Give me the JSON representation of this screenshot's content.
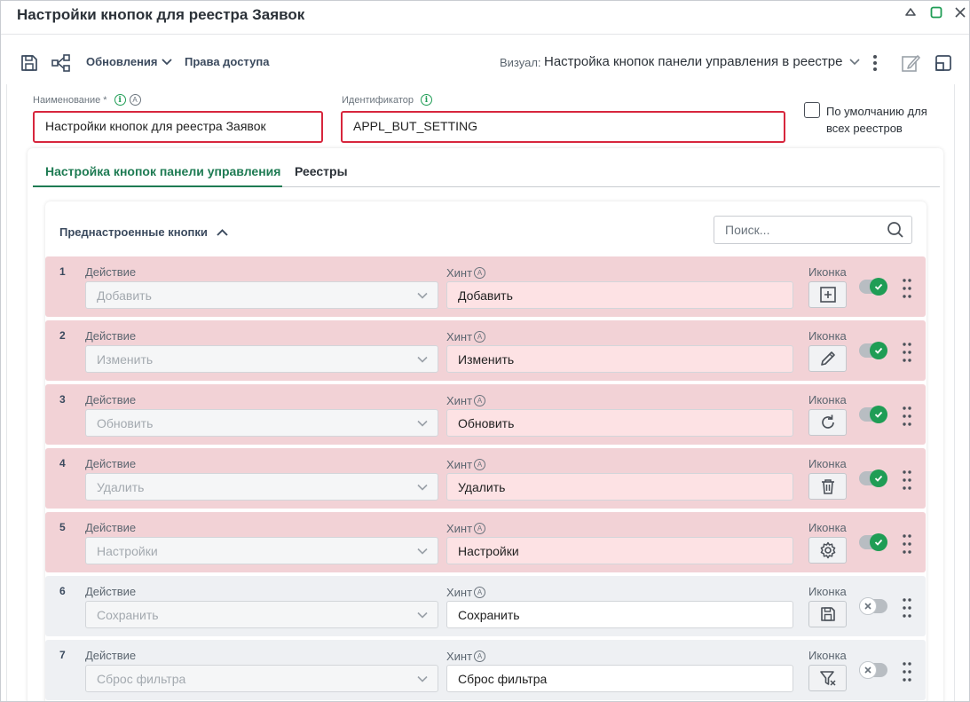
{
  "window": {
    "title": "Настройки кнопок для реестра Заявок"
  },
  "toolbar": {
    "save_icon": "save-icon",
    "structure_icon": "structure-icon",
    "updates_label": "Обновления",
    "access_label": "Права доступа",
    "visual_label": "Визуал:",
    "visual_value": "Настройка кнопок панели управления в реестре"
  },
  "form": {
    "name_label": "Наименование *",
    "name_value": "Настройки кнопок для реестра Заявок",
    "id_label": "Идентификатор",
    "id_value": "APPL_BUT_SETTING",
    "default_label_line1": "По умолчанию для",
    "default_label_line2": "всех реестров",
    "default_checked": false
  },
  "tabs": [
    {
      "label": "Настройка кнопок панели управления",
      "active": true
    },
    {
      "label": "Реестры",
      "active": false
    }
  ],
  "section": {
    "title": "Преднастроенные кнопки",
    "search_placeholder": "Поиск..."
  },
  "labels": {
    "action": "Действие",
    "hint": "Хинт",
    "icon": "Иконка"
  },
  "rows": [
    {
      "num": "1",
      "action": "Добавить",
      "hint": "Добавить",
      "icon": "add-square-icon",
      "enabled": true
    },
    {
      "num": "2",
      "action": "Изменить",
      "hint": "Изменить",
      "icon": "pencil-icon",
      "enabled": true
    },
    {
      "num": "3",
      "action": "Обновить",
      "hint": "Обновить",
      "icon": "refresh-icon",
      "enabled": true
    },
    {
      "num": "4",
      "action": "Удалить",
      "hint": "Удалить",
      "icon": "trash-icon",
      "enabled": true
    },
    {
      "num": "5",
      "action": "Настройки",
      "hint": "Настройки",
      "icon": "gear-icon",
      "enabled": true
    },
    {
      "num": "6",
      "action": "Сохранить",
      "hint": "Сохранить",
      "icon": "save-icon",
      "enabled": false
    },
    {
      "num": "7",
      "action": "Сброс фильтра",
      "hint": "Сброс фильтра",
      "icon": "filter-clear-icon",
      "enabled": false
    }
  ],
  "colors": {
    "accent": "#1e7b53",
    "error_border": "#d7263d",
    "row_enabled_bg": "#f2d2d6",
    "row_disabled_bg": "#eef0f3"
  }
}
